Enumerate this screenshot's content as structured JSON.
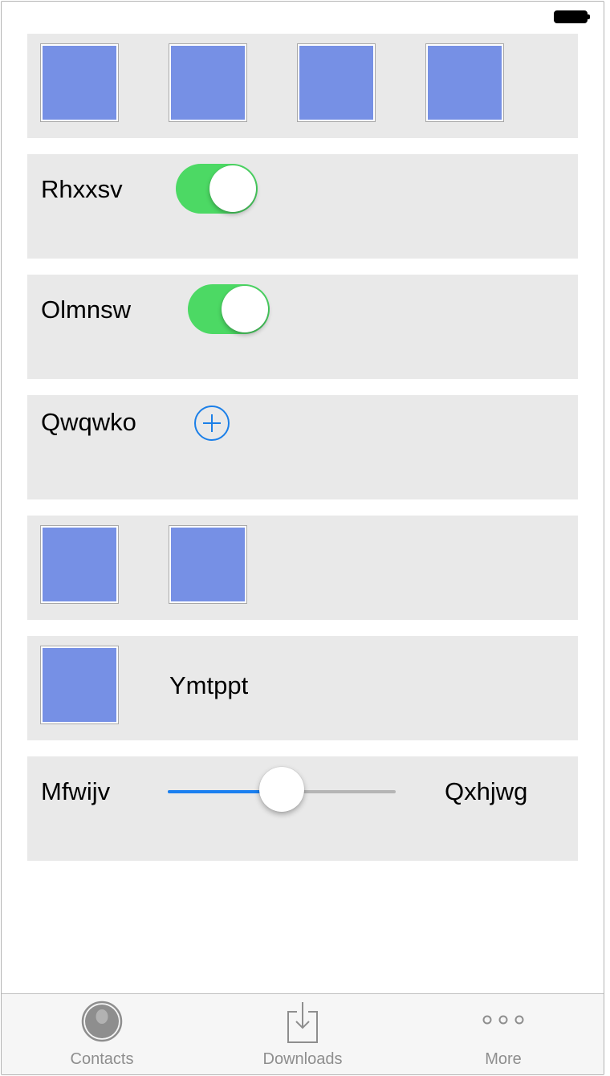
{
  "cards": {
    "toggle1": {
      "label": "Rhxxsv",
      "on": true
    },
    "toggle2": {
      "label": "Olmnsw",
      "on": true
    },
    "add": {
      "label": "Qwqwko"
    },
    "image_label": {
      "label": "Ymtppt"
    },
    "slider": {
      "min_label": "Mfwijv",
      "max_label": "Qxhjwg",
      "value_fraction": 0.5
    }
  },
  "tabbar": {
    "tabs": [
      {
        "label": "Contacts",
        "icon": "person-silhouette-icon"
      },
      {
        "label": "Downloads",
        "icon": "download-tray-icon"
      },
      {
        "label": "More",
        "icon": "more-dots-icon"
      }
    ]
  },
  "colors": {
    "switch_on": "#4cd964",
    "accent_blue": "#1a7ff0",
    "tile_fill": "#7690e5",
    "card_bg": "#e9e9e9"
  }
}
